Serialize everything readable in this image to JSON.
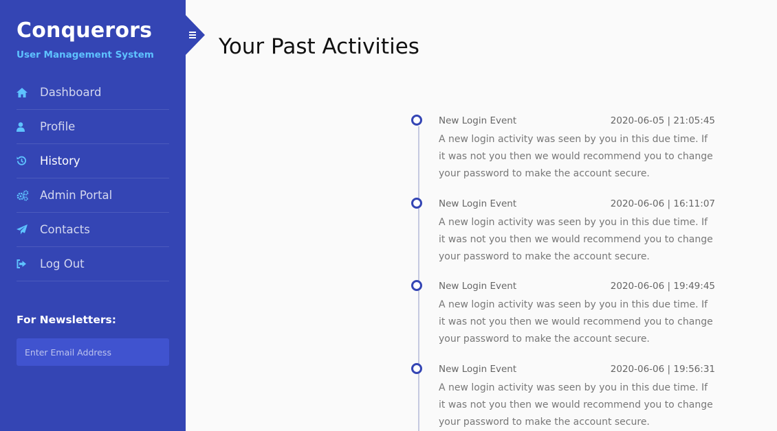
{
  "sidebar": {
    "brand": "Conquerors",
    "subtitle": "User Management System",
    "items": [
      {
        "label": "Dashboard",
        "icon": "home-icon"
      },
      {
        "label": "Profile",
        "icon": "user-icon"
      },
      {
        "label": "History",
        "icon": "history-icon",
        "active": true
      },
      {
        "label": "Admin Portal",
        "icon": "cogs-icon"
      },
      {
        "label": "Contacts",
        "icon": "paper-plane-icon"
      },
      {
        "label": "Log Out",
        "icon": "sign-out-icon"
      }
    ],
    "newsletter": {
      "title": "For Newsletters:",
      "placeholder": "Enter Email Address"
    }
  },
  "main": {
    "title": "Your Past Activities",
    "events": [
      {
        "title": "New Login Event",
        "timestamp": "2020-06-05 | 21:05:45",
        "description": "A new login activity was seen by you in this due time. If it was not you then we would recommend you to change your password to make the account secure."
      },
      {
        "title": "New Login Event",
        "timestamp": "2020-06-06 | 16:11:07",
        "description": "A new login activity was seen by you in this due time. If it was not you then we would recommend you to change your password to make the account secure."
      },
      {
        "title": "New Login Event",
        "timestamp": "2020-06-06 | 19:49:45",
        "description": "A new login activity was seen by you in this due time. If it was not you then we would recommend you to change your password to make the account secure."
      },
      {
        "title": "New Login Event",
        "timestamp": "2020-06-06 | 19:56:31",
        "description": "A new login activity was seen by you in this due time. If it was not you then we would recommend you to change your password to make the account secure."
      }
    ]
  },
  "colors": {
    "sidebar_bg": "#3445b4",
    "accent": "#5ec2ff",
    "timeline_dot": "#3445b4",
    "page_bg": "#fafafa"
  }
}
